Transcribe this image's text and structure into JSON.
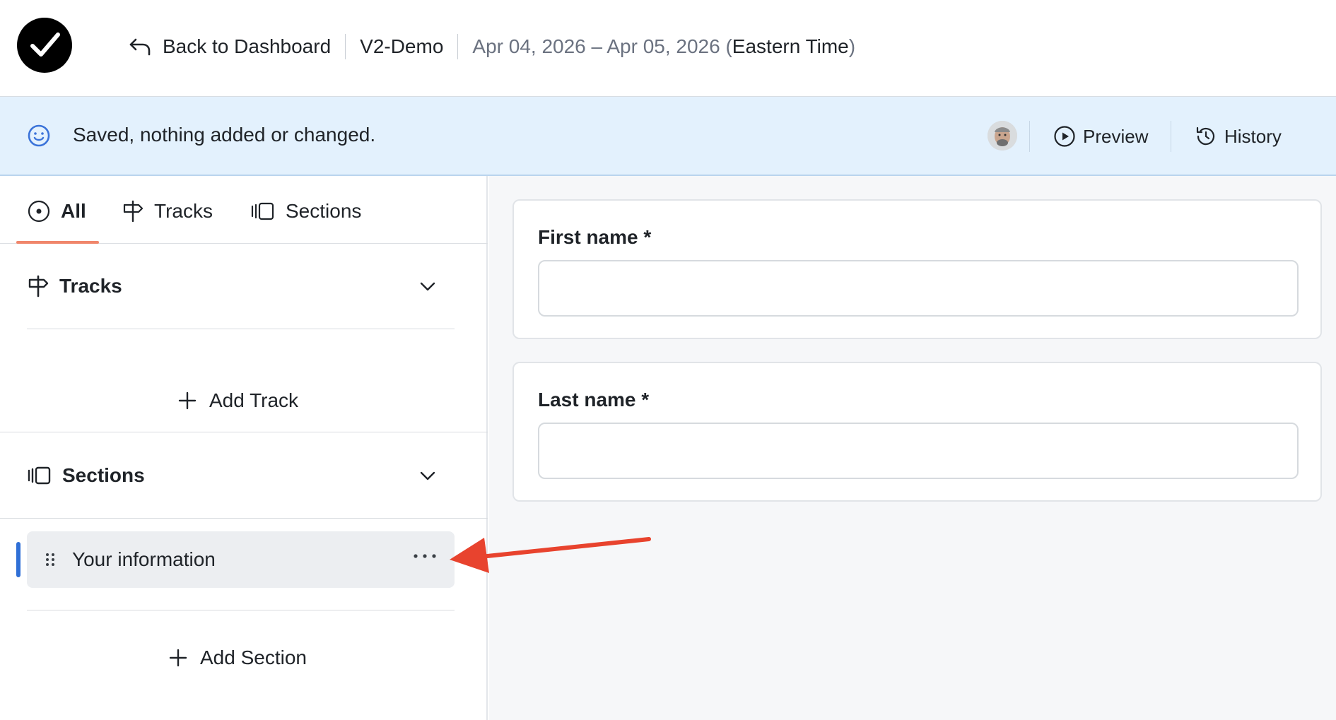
{
  "header": {
    "back_label": "Back to Dashboard",
    "event_name": "V2-Demo",
    "date_range": "Apr 04, 2026 – Apr 05, 2026 (",
    "timezone": "Eastern Time",
    "tz_close": ")"
  },
  "banner": {
    "status_message": "Saved, nothing added or changed.",
    "preview_label": "Preview",
    "history_label": "History",
    "background_color": "#e3f1fd"
  },
  "tabs": [
    {
      "label": "All",
      "icon": "target-icon",
      "active": true
    },
    {
      "label": "Tracks",
      "icon": "signpost-icon",
      "active": false
    },
    {
      "label": "Sections",
      "icon": "sections-icon",
      "active": false
    }
  ],
  "tracks_panel": {
    "title": "Tracks",
    "add_label": "Add Track"
  },
  "sections_panel": {
    "title": "Sections",
    "items": [
      {
        "label": "Your information",
        "selected": true
      }
    ],
    "add_label": "Add Section"
  },
  "form": {
    "fields": [
      {
        "label": "First name *",
        "value": "",
        "placeholder": ""
      },
      {
        "label": "Last name *",
        "value": "",
        "placeholder": ""
      }
    ]
  },
  "colors": {
    "accent_underline": "#f0866b",
    "selection_bar": "#2f6fd6",
    "annotation_arrow": "#e8432e"
  }
}
